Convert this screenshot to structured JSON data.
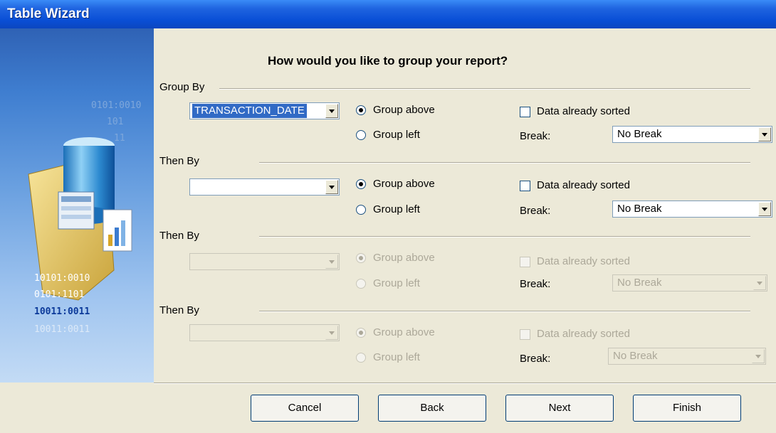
{
  "window": {
    "title": "Table Wizard"
  },
  "heading": "How would you like to group your report?",
  "groups": [
    {
      "label": "Group By",
      "field": "TRANSACTION_DATE",
      "group_above": "Group above",
      "group_left": "Group left",
      "sorted": "Data already sorted",
      "break_label": "Break:",
      "break_value": "No Break",
      "enabled": true,
      "field_selected": true
    },
    {
      "label": "Then By",
      "field": "",
      "group_above": "Group above",
      "group_left": "Group left",
      "sorted": "Data already sorted",
      "break_label": "Break:",
      "break_value": "No Break",
      "enabled": true
    },
    {
      "label": "Then By",
      "field": "",
      "group_above": "Group above",
      "group_left": "Group left",
      "sorted": "Data already sorted",
      "break_label": "Break:",
      "break_value": "No Break",
      "enabled": false
    },
    {
      "label": "Then By",
      "field": "",
      "group_above": "Group above",
      "group_left": "Group left",
      "sorted": "Data already sorted",
      "break_label": "Break:",
      "break_value": "No Break",
      "enabled": false
    }
  ],
  "side_image": {
    "binary_lines": [
      "0101:0010",
      "0101:1101",
      "10011:0011",
      "10011:0011",
      "10101:0010"
    ]
  },
  "buttons": {
    "cancel": "Cancel",
    "back": "Back",
    "next": "Next",
    "finish": "Finish"
  },
  "colors": {
    "titlebar": "#0A4FD6",
    "dialog_bg": "#ECE9D8",
    "selection": "#316AC5"
  }
}
